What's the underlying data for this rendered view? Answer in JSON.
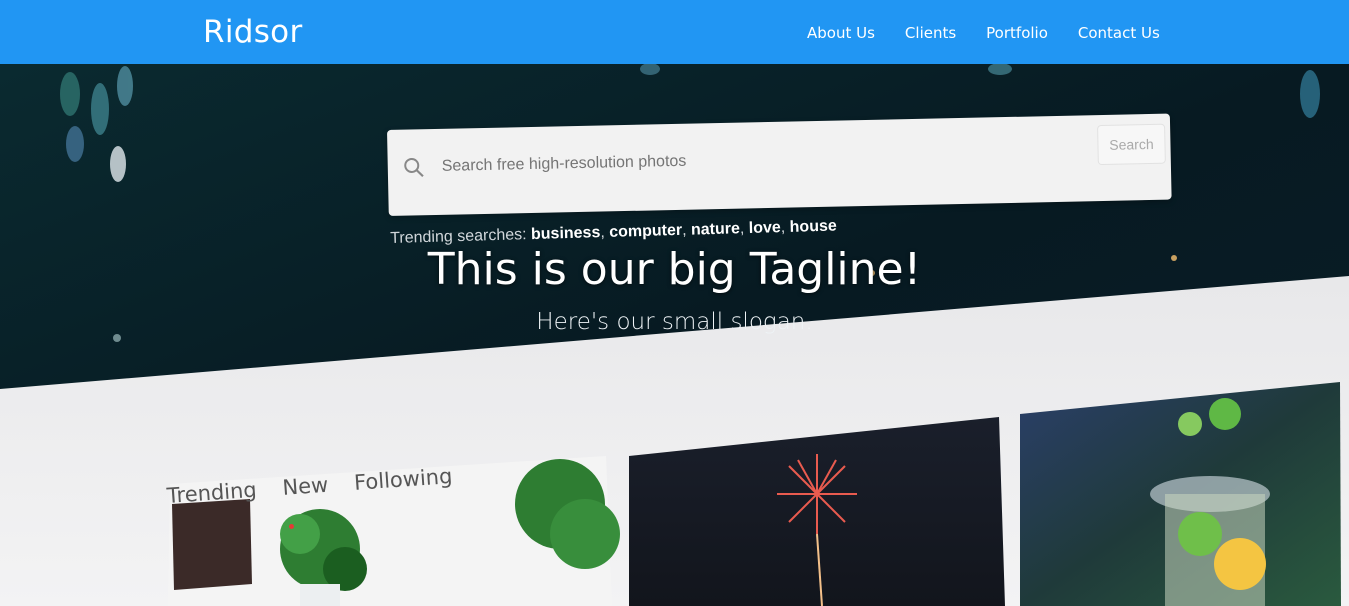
{
  "nav": {
    "brand": "Ridsor",
    "links": [
      "About Us",
      "Clients",
      "Portfolio",
      "Contact Us"
    ]
  },
  "hero": {
    "search": {
      "placeholder": "Search free high-resolution photos",
      "button_label": "Search"
    },
    "trending": {
      "label": "Trending searches:",
      "items": [
        "business",
        "computer",
        "nature",
        "love",
        "house"
      ]
    },
    "tagline": "This is our big Tagline!",
    "slogan": "Here's our small slogan.",
    "tabs": [
      "Trending",
      "New",
      "Following"
    ]
  },
  "colors": {
    "nav_bg": "#2196f3",
    "accent_dot": "#e53935"
  }
}
